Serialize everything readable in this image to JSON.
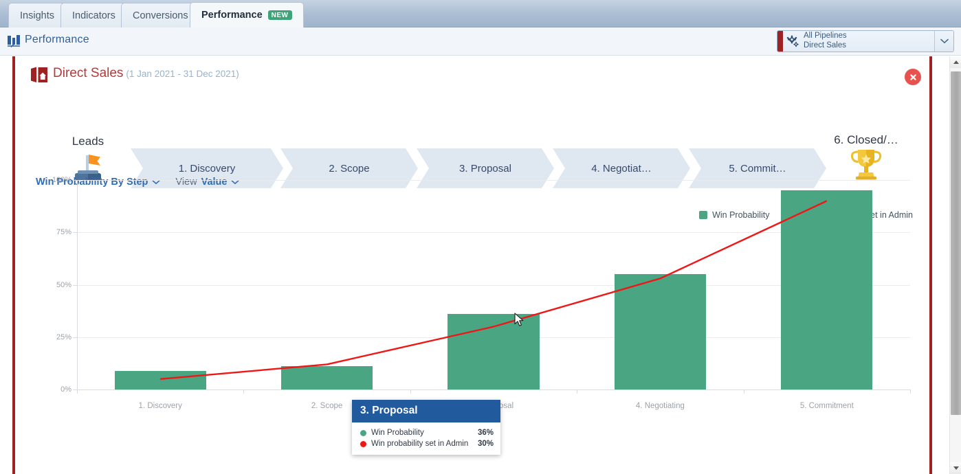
{
  "tabs": [
    {
      "label": "Insights",
      "active": false,
      "badge": null
    },
    {
      "label": "Indicators",
      "active": false,
      "badge": null
    },
    {
      "label": "Conversions",
      "active": false,
      "badge": null
    },
    {
      "label": "Performance",
      "active": true,
      "badge": "NEW"
    }
  ],
  "breadcrumb": {
    "label": "Performance",
    "icon": "report-bars-icon"
  },
  "pipeline_selector": {
    "line1": "All Pipelines",
    "line2": "Direct Sales",
    "icon": "gear-icon",
    "caret": "chevron-down-icon"
  },
  "panel": {
    "title": "Direct Sales",
    "date_range": "(1 Jan 2021 - 31 Dec 2021)",
    "icon": "pipeline-house-icon",
    "close": "close-icon"
  },
  "funnel": {
    "leads": {
      "label": "Leads",
      "icon": "flag-icon"
    },
    "stages": [
      {
        "label": "1. Discovery"
      },
      {
        "label": "2. Scope"
      },
      {
        "label": "3. Proposal"
      },
      {
        "label": "4. Negotiat…"
      },
      {
        "label": "5. Commit…"
      }
    ],
    "closed": {
      "label": "6. Closed/…",
      "icon": "trophy-icon"
    }
  },
  "controls": {
    "metric_label": "Win Probability By Step",
    "metric_caret": "chevron-down-icon",
    "view_prefix": "View",
    "view_value": "Value",
    "view_caret": "chevron-down-icon"
  },
  "legend": [
    {
      "label": "Win Probability",
      "type": "swatch",
      "color": "#4aa583"
    },
    {
      "label": "Win probability set in Admin",
      "type": "line",
      "color": "#f01616"
    }
  ],
  "tooltip": {
    "title": "3. Proposal",
    "rows": [
      {
        "label": "Win Probability",
        "value": "36%",
        "color": "#4aa583"
      },
      {
        "label": "Win probability set in Admin",
        "value": "30%",
        "color": "#f01616"
      }
    ]
  },
  "chart_data": {
    "type": "bar",
    "title": "Win Probability By Step",
    "xlabel": "",
    "ylabel": "",
    "ylim": [
      0,
      100
    ],
    "ytick_labels": [
      "0%",
      "25%",
      "50%",
      "75%",
      "100%"
    ],
    "ytick_values": [
      0,
      25,
      50,
      75,
      100
    ],
    "grid": true,
    "legend_position": "top-right",
    "categories": [
      "1. Discovery",
      "2. Scope",
      "3. Proposal",
      "4. Negotiating",
      "5. Commitment"
    ],
    "series": [
      {
        "name": "Win Probability",
        "type": "bar",
        "color": "#4aa583",
        "values": [
          9,
          11,
          36,
          55,
          95
        ]
      },
      {
        "name": "Win probability set in Admin",
        "type": "line",
        "color": "#f01616",
        "values": [
          5,
          12,
          30,
          53,
          90
        ]
      }
    ]
  },
  "scrollbar": {
    "up": "scroll-up-arrow",
    "down": "scroll-down-arrow"
  }
}
